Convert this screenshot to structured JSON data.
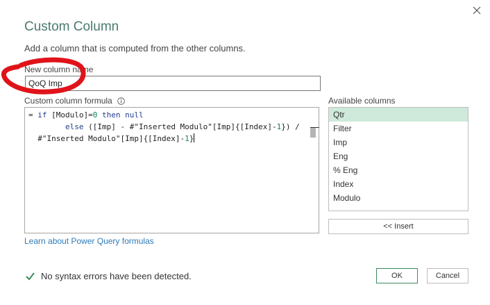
{
  "dialog": {
    "title": "Custom Column",
    "subtitle": "Add a column that is computed from the other columns.",
    "new_column_label": "New column name",
    "new_column_value": "QoQ Imp",
    "formula_label": "Custom column formula",
    "formula_lines": [
      "= if [Modulo]=0 then null",
      "        else ([Imp] - #\"Inserted Modulo\"[Imp]{[Index]-1}) /",
      "  #\"Inserted Modulo\"[Imp]{[Index]-1}"
    ],
    "available_label": "Available columns",
    "available_columns": [
      "Qtr",
      "Filter",
      "Imp",
      "Eng",
      "% Eng",
      "Index",
      "Modulo"
    ],
    "selected_column": "Qtr",
    "insert_label": "<< Insert",
    "learn_link": "Learn about Power Query formulas",
    "status_text": "No syntax errors have been detected.",
    "ok_label": "OK",
    "cancel_label": "Cancel"
  },
  "icons": {
    "close": "close-icon",
    "info": "info-icon",
    "status": "checkmark-icon"
  },
  "colors": {
    "title": "#4a7a6e",
    "selected_item": "#cfe9da",
    "link": "#2e7ab8",
    "check": "#3c8a5a",
    "annotation": "#e0131a"
  }
}
